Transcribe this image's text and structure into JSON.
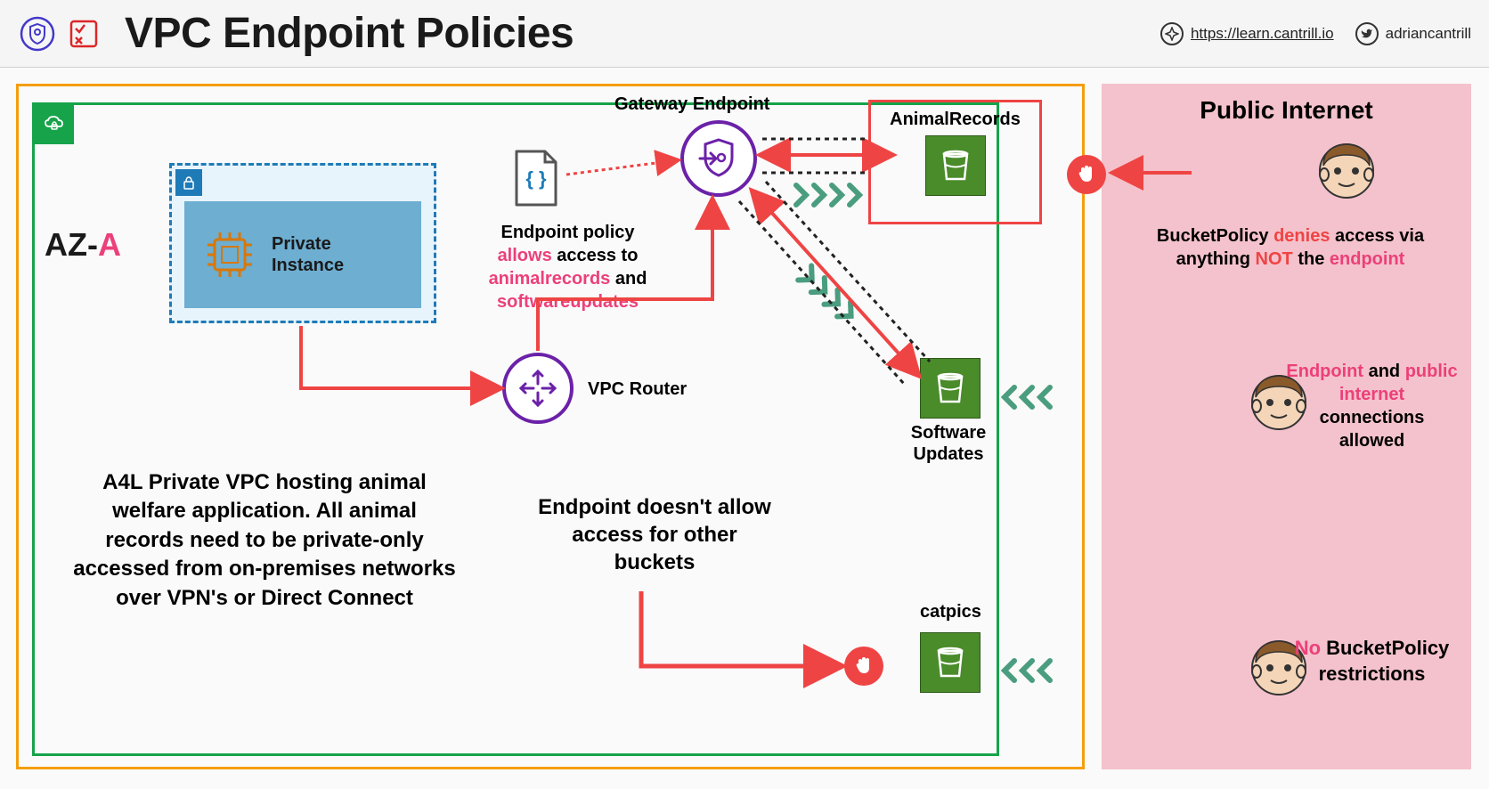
{
  "header": {
    "title": "VPC Endpoint Policies",
    "link_url": "https://learn.cantrill.io",
    "twitter_handle": "adriancantrill"
  },
  "az": {
    "prefix": "AZ-",
    "suffix": "A"
  },
  "instance": {
    "label": "Private Instance"
  },
  "policy": {
    "line1": "Endpoint policy",
    "allows": "allows",
    "line2": " access to",
    "bucket1": "animalrecords",
    "and": " and",
    "bucket2": "softwareupdates"
  },
  "gateway": {
    "label": "Gateway Endpoint"
  },
  "router": {
    "label": "VPC Router"
  },
  "buckets": {
    "animal": "AnimalRecords",
    "software": "Software Updates",
    "catpics": "catpics"
  },
  "vpc_desc": "A4L Private VPC hosting animal welfare application. All animal records need to be private-only accessed from on-premises networks over VPN's or Direct Connect",
  "endpoint_deny": "Endpoint doesn't allow access for other buckets",
  "public": {
    "title": "Public Internet",
    "user1": {
      "prefix": "BucketPolicy ",
      "denies": "denies",
      "mid": " access via anything ",
      "not": "NOT",
      "mid2": " the ",
      "endpoint": "endpoint"
    },
    "user2": {
      "endpoint": "Endpoint",
      "and": " and ",
      "pubint": "public internet",
      "rest": " connections allowed"
    },
    "user3": {
      "no": "No",
      "rest": " BucketPolicy restrictions"
    }
  }
}
